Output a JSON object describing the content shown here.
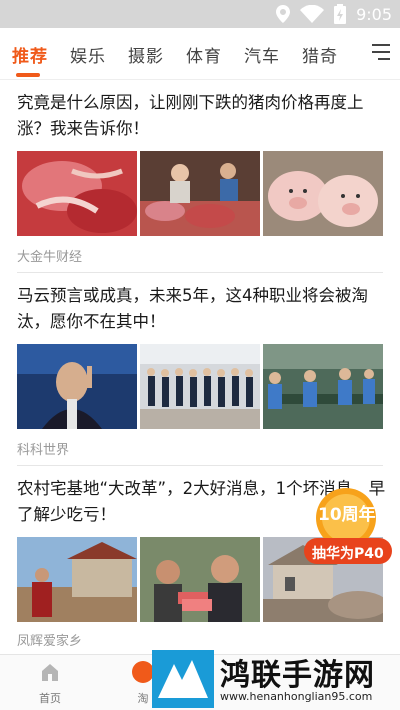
{
  "status": {
    "time": "9:05"
  },
  "tabs": [
    {
      "label": "推荐",
      "active": true
    },
    {
      "label": "娱乐",
      "active": false
    },
    {
      "label": "摄影",
      "active": false
    },
    {
      "label": "体育",
      "active": false
    },
    {
      "label": "汽车",
      "active": false
    },
    {
      "label": "猎奇",
      "active": false
    }
  ],
  "articles": [
    {
      "headline": "究竟是什么原因，让刚刚下跌的猪肉价格再度上涨？我来告诉你！",
      "source": "大金牛财经",
      "images": [
        "raw-pork-meat",
        "pork-market-stall",
        "piglets"
      ]
    },
    {
      "headline": "马云预言或成真，未来5年，这4种职业将会被淘汰，愿你不在其中！",
      "source": "科科世界",
      "images": [
        "man-speaking-on-stage",
        "staff-lined-up-in-lobby",
        "factory-workers-assembly-line"
      ]
    },
    {
      "headline": "农村宅基地“大改革”，2大好消息，1个坏消息，早了解少吃亏！",
      "source": "凤辉爱家乡",
      "images": [
        "village-house-with-man",
        "elderly-villagers-with-money",
        "demolished-village-houses"
      ]
    }
  ],
  "ad": {
    "line1": "10周年",
    "line2": "抽华为P40"
  },
  "bottom_nav": [
    {
      "label": "首页",
      "icon": "home-icon"
    },
    {
      "label": "淘",
      "icon": "taobao-icon"
    }
  ],
  "watermark": {
    "title": "鸿联手游网",
    "url": "www.henanhonglian95.com"
  },
  "colors": {
    "accent": "#f05a1a",
    "status_bar": "#d6d6d6",
    "source_text": "#999999"
  }
}
